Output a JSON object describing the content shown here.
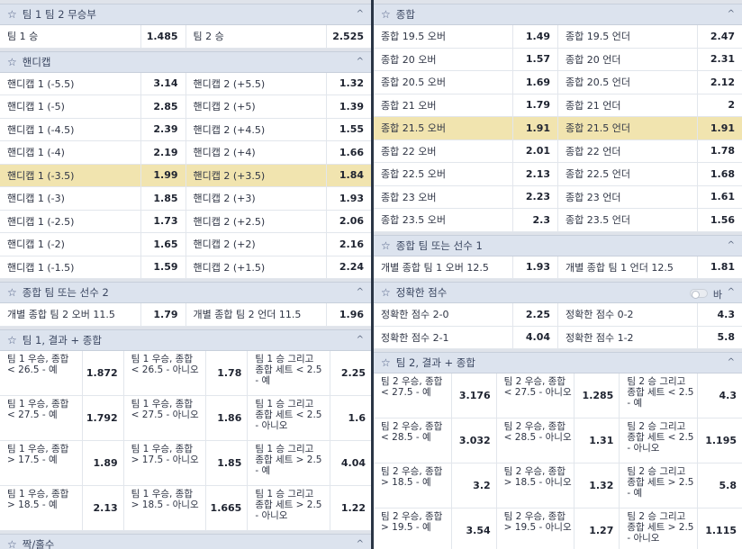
{
  "left": {
    "s1": {
      "title": "팀 1 팀 2 무승부",
      "rows": [
        [
          {
            "n": "팀 1 승",
            "o": "1.485"
          },
          {
            "n": "팀 2 승",
            "o": "2.525"
          }
        ]
      ]
    },
    "s2": {
      "title": "핸디캡",
      "rows": [
        [
          {
            "n": "핸디캡 1 (-5.5)",
            "o": "3.14"
          },
          {
            "n": "핸디캡 2 (+5.5)",
            "o": "1.32"
          }
        ],
        [
          {
            "n": "핸디캡 1 (-5)",
            "o": "2.85"
          },
          {
            "n": "핸디캡 2 (+5)",
            "o": "1.39"
          }
        ],
        [
          {
            "n": "핸디캡 1 (-4.5)",
            "o": "2.39"
          },
          {
            "n": "핸디캡 2 (+4.5)",
            "o": "1.55"
          }
        ],
        [
          {
            "n": "핸디캡 1 (-4)",
            "o": "2.19"
          },
          {
            "n": "핸디캡 2 (+4)",
            "o": "1.66"
          }
        ],
        [
          {
            "n": "핸디캡 1 (-3.5)",
            "o": "1.99"
          },
          {
            "n": "핸디캡 2 (+3.5)",
            "o": "1.84"
          }
        ],
        [
          {
            "n": "핸디캡 1 (-3)",
            "o": "1.85"
          },
          {
            "n": "핸디캡 2 (+3)",
            "o": "1.93"
          }
        ],
        [
          {
            "n": "핸디캡 1 (-2.5)",
            "o": "1.73"
          },
          {
            "n": "핸디캡 2 (+2.5)",
            "o": "2.06"
          }
        ],
        [
          {
            "n": "핸디캡 1 (-2)",
            "o": "1.65"
          },
          {
            "n": "핸디캡 2 (+2)",
            "o": "2.16"
          }
        ],
        [
          {
            "n": "핸디캡 1 (-1.5)",
            "o": "1.59"
          },
          {
            "n": "핸디캡 2 (+1.5)",
            "o": "2.24"
          }
        ]
      ]
    },
    "s3": {
      "title": "종합 팀 또는 선수 2",
      "rows": [
        [
          {
            "n": "개별 종합 팀 2 오버 11.5",
            "o": "1.79"
          },
          {
            "n": "개별 종합 팀 2 언더 11.5",
            "o": "1.96"
          }
        ]
      ]
    },
    "s4": {
      "title": "팀 1, 결과 + 종합",
      "rows": [
        [
          {
            "n": "팀 1 우승, 종합\n< 26.5 - 예",
            "o": "1.872"
          },
          {
            "n": "팀 1 우승, 종합\n< 26.5 - 아니오",
            "o": "1.78"
          },
          {
            "n": "팀 1 승 그리고\n종합 세트 < 2.5\n- 예",
            "o": "2.25"
          }
        ],
        [
          {
            "n": "팀 1 우승, 종합\n< 27.5 - 예",
            "o": "1.792"
          },
          {
            "n": "팀 1 우승, 종합\n< 27.5 - 아니오",
            "o": "1.86"
          },
          {
            "n": "팀 1 승 그리고\n종합 세트 < 2.5\n- 아니오",
            "o": "1.6"
          }
        ],
        [
          {
            "n": "팀 1 우승, 종합\n> 17.5 - 예",
            "o": "1.89"
          },
          {
            "n": "팀 1 우승, 종합\n> 17.5 - 아니오",
            "o": "1.85"
          },
          {
            "n": "팀 1 승 그리고\n종합 세트 > 2.5\n- 예",
            "o": "4.04"
          }
        ],
        [
          {
            "n": "팀 1 우승, 종합\n> 18.5 - 예",
            "o": "2.13"
          },
          {
            "n": "팀 1 우승, 종합\n> 18.5 - 아니오",
            "o": "1.665"
          },
          {
            "n": "팀 1 승 그리고\n종합 세트 > 2.5\n- 아니오",
            "o": "1.22"
          }
        ]
      ]
    },
    "s5": {
      "title": "짝/홀수"
    }
  },
  "right": {
    "s1": {
      "title": "종합",
      "rows": [
        [
          {
            "n": "종합 19.5 오버",
            "o": "1.49"
          },
          {
            "n": "종합 19.5 언더",
            "o": "2.47"
          }
        ],
        [
          {
            "n": "종합 20 오버",
            "o": "1.57"
          },
          {
            "n": "종합 20 언더",
            "o": "2.31"
          }
        ],
        [
          {
            "n": "종합 20.5 오버",
            "o": "1.69"
          },
          {
            "n": "종합 20.5 언더",
            "o": "2.12"
          }
        ],
        [
          {
            "n": "종합 21 오버",
            "o": "1.79"
          },
          {
            "n": "종합 21 언더",
            "o": "2"
          }
        ],
        [
          {
            "n": "종합 21.5 오버",
            "o": "1.91"
          },
          {
            "n": "종합 21.5 언더",
            "o": "1.91"
          }
        ],
        [
          {
            "n": "종합 22 오버",
            "o": "2.01"
          },
          {
            "n": "종합 22 언더",
            "o": "1.78"
          }
        ],
        [
          {
            "n": "종합 22.5 오버",
            "o": "2.13"
          },
          {
            "n": "종합 22.5 언더",
            "o": "1.68"
          }
        ],
        [
          {
            "n": "종합 23 오버",
            "o": "2.23"
          },
          {
            "n": "종합 23 언더",
            "o": "1.61"
          }
        ],
        [
          {
            "n": "종합 23.5 오버",
            "o": "2.3"
          },
          {
            "n": "종합 23.5 언더",
            "o": "1.56"
          }
        ]
      ]
    },
    "s2": {
      "title": "종합 팀 또는 선수 1",
      "rows": [
        [
          {
            "n": "개별 종합 팀 1 오버 12.5",
            "o": "1.93"
          },
          {
            "n": "개별 종합 팀 1 언더 12.5",
            "o": "1.81"
          }
        ]
      ]
    },
    "s3": {
      "title": "정확한 점수",
      "toggle_label": "바",
      "rows": [
        [
          {
            "n": "정확한 점수 2-0",
            "o": "2.25"
          },
          {
            "n": "정확한 점수 0-2",
            "o": "4.3"
          }
        ],
        [
          {
            "n": "정확한 점수 2-1",
            "o": "4.04"
          },
          {
            "n": "정확한 점수 1-2",
            "o": "5.8"
          }
        ]
      ]
    },
    "s4": {
      "title": "팀 2, 결과 + 종합",
      "rows": [
        [
          {
            "n": "팀 2 우승, 종합\n< 27.5 - 예",
            "o": "3.176"
          },
          {
            "n": "팀 2 우승, 종합\n< 27.5 - 아니오",
            "o": "1.285"
          },
          {
            "n": "팀 2 승 그리고\n종합 세트 < 2.5\n- 예",
            "o": "4.3"
          }
        ],
        [
          {
            "n": "팀 2 우승, 종합\n< 28.5 - 예",
            "o": "3.032"
          },
          {
            "n": "팀 2 우승, 종합\n< 28.5 - 아니오",
            "o": "1.31"
          },
          {
            "n": "팀 2 승 그리고\n종합 세트 < 2.5\n- 아니오",
            "o": "1.195"
          }
        ],
        [
          {
            "n": "팀 2 우승, 종합\n> 18.5 - 예",
            "o": "3.2"
          },
          {
            "n": "팀 2 우승, 종합\n> 18.5 - 아니오",
            "o": "1.32"
          },
          {
            "n": "팀 2 승 그리고\n종합 세트 > 2.5\n- 예",
            "o": "5.8"
          }
        ],
        [
          {
            "n": "팀 2 우승, 종합\n> 19.5 - 예",
            "o": "3.54"
          },
          {
            "n": "팀 2 우승, 종합\n> 19.5 - 아니오",
            "o": "1.27"
          },
          {
            "n": "팀 2 승 그리고\n종합 세트 > 2.5\n- 아니오",
            "o": "1.115"
          }
        ]
      ]
    }
  },
  "icons": {
    "star": "star-icon",
    "collapse": "chevron-up-icon"
  }
}
